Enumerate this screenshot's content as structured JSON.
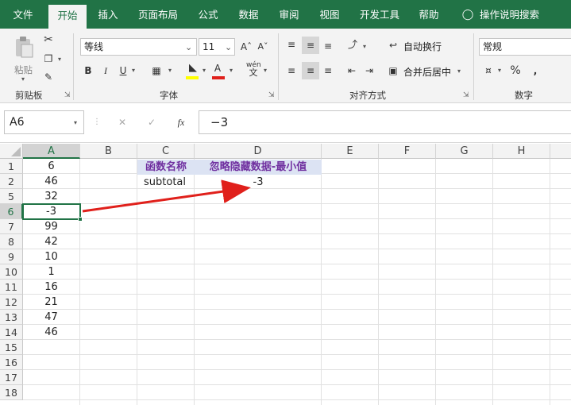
{
  "ribbon_tabs": [
    "文件",
    "开始",
    "插入",
    "页面布局",
    "公式",
    "数据",
    "审阅",
    "视图",
    "开发工具",
    "帮助",
    "操作说明搜索"
  ],
  "clipboard": {
    "paste_label": "粘贴",
    "group_label": "剪贴板"
  },
  "font": {
    "name": "等线",
    "size": "11",
    "bold": "B",
    "italic": "I",
    "underline": "U",
    "group_label": "字体",
    "color_letter": "A",
    "phonetic_top": "wén",
    "phonetic_bottom": "文"
  },
  "alignment": {
    "wrap_text": "自动换行",
    "merge_center": "合并后居中",
    "group_label": "对齐方式"
  },
  "number": {
    "format": "常规",
    "percent": "%",
    "group_label": "数字"
  },
  "formula_bar": {
    "name_box": "A6",
    "cancel": "✕",
    "enter": "✓",
    "fx": "fx",
    "formula": "−3"
  },
  "columns": [
    "A",
    "B",
    "C",
    "D",
    "E",
    "F",
    "G",
    "H"
  ],
  "row_numbers": [
    "1",
    "2",
    "5",
    "6",
    "7",
    "8",
    "9",
    "10",
    "11",
    "12",
    "13",
    "14",
    "15",
    "16",
    "17",
    "18"
  ],
  "column_a_values": [
    "6",
    "46",
    "32",
    "-3",
    "99",
    "42",
    "10",
    "1",
    "16",
    "21",
    "47",
    "46"
  ],
  "table": {
    "header_function": "函数名称",
    "header_result": "忽略隐藏数据-最小值",
    "function_name": "subtotal",
    "result": "-3"
  },
  "colors": {
    "excel_green": "#217346",
    "header_fill": "#dce3f3",
    "header_text": "#7030a0",
    "arrow": "#e0201b"
  }
}
